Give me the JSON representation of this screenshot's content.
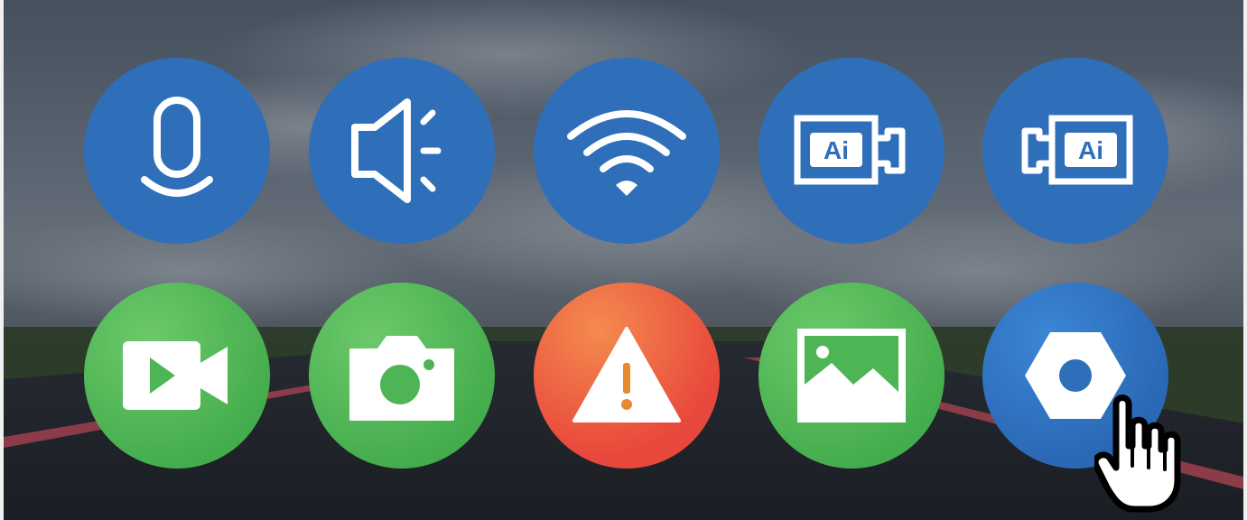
{
  "colors": {
    "blue": "#2f6fba",
    "green": "#4db555",
    "warning": "#eb5a3e",
    "icon": "#ffffff",
    "warning_dot": "#e9892f"
  },
  "tiles": [
    {
      "icon": "microphone-icon",
      "color": "blue"
    },
    {
      "icon": "speaker-icon",
      "color": "blue"
    },
    {
      "icon": "wifi-icon",
      "color": "blue"
    },
    {
      "icon": "ai-camera-front-icon",
      "color": "blue",
      "label": "Ai"
    },
    {
      "icon": "ai-camera-rear-icon",
      "color": "blue",
      "label": "Ai"
    },
    {
      "icon": "video-record-icon",
      "color": "green"
    },
    {
      "icon": "camera-icon",
      "color": "green"
    },
    {
      "icon": "warning-icon",
      "color": "warning"
    },
    {
      "icon": "gallery-icon",
      "color": "green"
    },
    {
      "icon": "settings-hex-icon",
      "color": "blue"
    }
  ],
  "cursor": {
    "icon": "pointer-hand-icon",
    "target": "settings"
  }
}
